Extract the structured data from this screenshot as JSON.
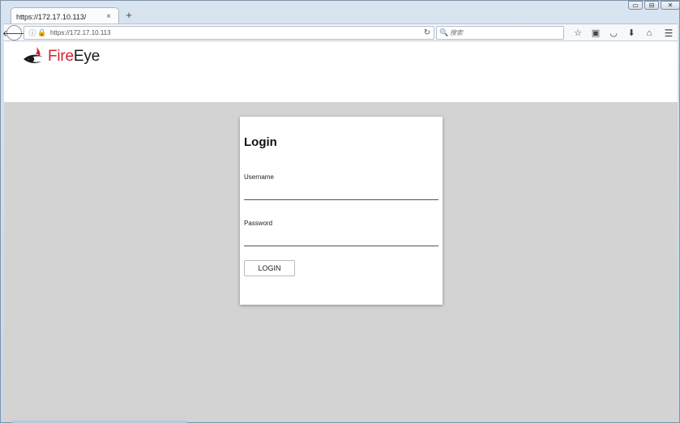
{
  "browser": {
    "tab_title": "https://172.17.10.113/",
    "tab_close": "×",
    "new_tab": "+",
    "url": "https://172.17.10.113",
    "search_placeholder": "搜索",
    "window_controls": [
      "▭",
      "⊟",
      "✕"
    ]
  },
  "page": {
    "logo": {
      "part1": "Fire",
      "part2": "Eye"
    },
    "login": {
      "title": "Login",
      "username_label": "Username",
      "username_value": "",
      "password_label": "Password",
      "password_value": "",
      "button_label": "LOGIN"
    }
  },
  "colors": {
    "brand_red": "#d3202b",
    "content_background": "#d3d3d3"
  }
}
